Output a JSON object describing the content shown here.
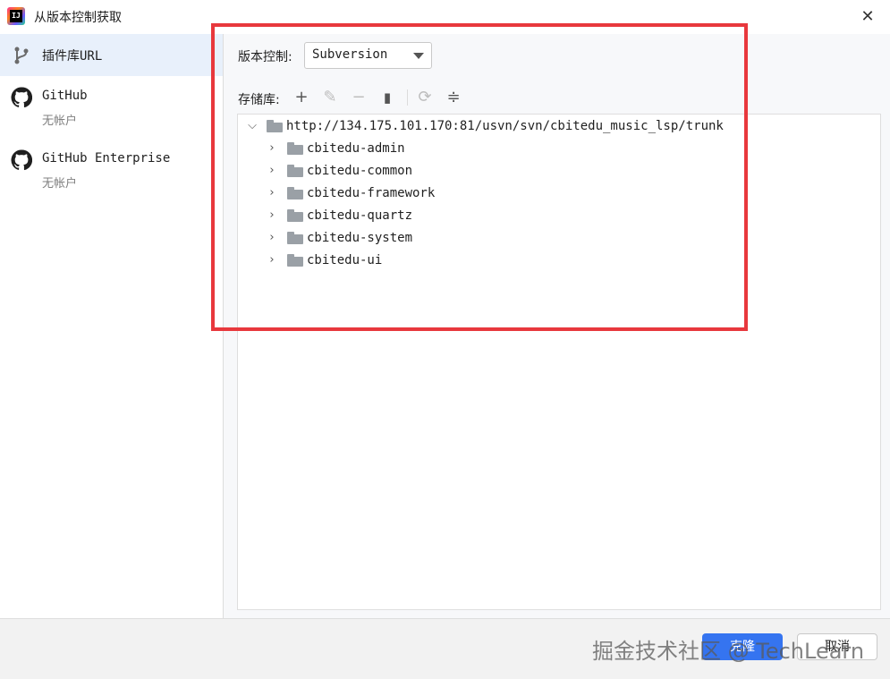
{
  "window": {
    "title": "从版本控制获取",
    "app_icon_text": "IJ",
    "close_glyph": "✕"
  },
  "sidebar": {
    "items": [
      {
        "label": "插件库URL",
        "sub": "",
        "icon": "vcs-branch-icon",
        "selected": true
      },
      {
        "label": "GitHub",
        "sub": "无帐户",
        "icon": "github-icon",
        "selected": false
      },
      {
        "label": "GitHub Enterprise",
        "sub": "无帐户",
        "icon": "github-icon",
        "selected": false
      }
    ]
  },
  "main": {
    "vcs_label": "版本控制:",
    "vcs_value": "Subversion",
    "repo_label": "存储库:",
    "toolbar": {
      "add": "+",
      "edit": "✎",
      "remove": "−",
      "copy": "▮",
      "refresh": "⟳",
      "collapse": "≑"
    },
    "tree": {
      "root": "http://134.175.101.170:81/usvn/svn/cbitedu_music_lsp/trunk",
      "children": [
        "cbitedu-admin",
        "cbitedu-common",
        "cbitedu-framework",
        "cbitedu-quartz",
        "cbitedu-system",
        "cbitedu-ui"
      ]
    }
  },
  "footer": {
    "primary_label": "克隆",
    "secondary_label": "取消",
    "watermark": "掘金技术社区 @ TechLearn"
  },
  "colors": {
    "accent": "#3574f0",
    "highlight": "#e8383d",
    "selected_bg": "#e8f0fb"
  }
}
